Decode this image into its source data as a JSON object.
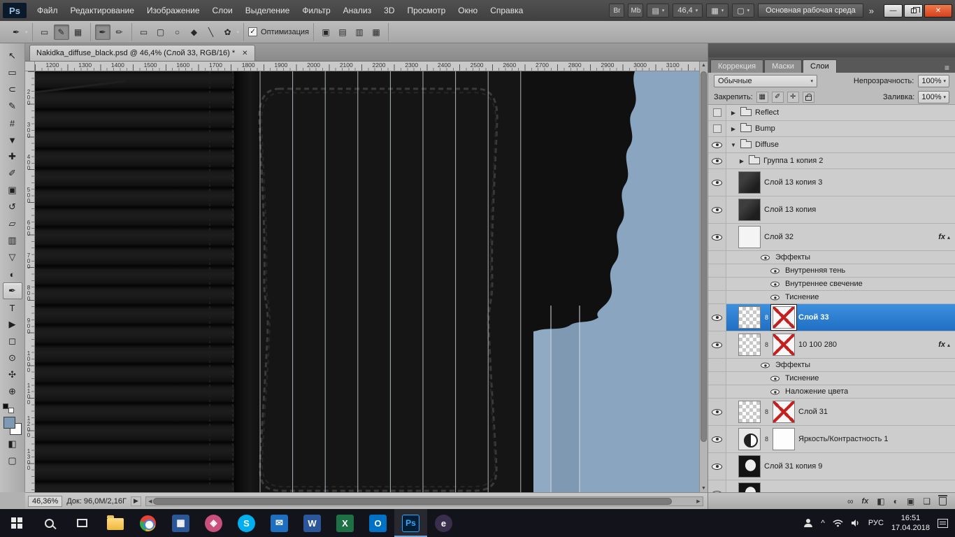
{
  "colors": {
    "selection_blue": "#2a7fd0",
    "canvas_blue": "#8aa5c0",
    "canvas_blue_dark": "#7f99b3",
    "canvas_blue_light": "#90aac3",
    "foreground_swatch": "#7d99b4",
    "background_swatch": "#ffffff"
  },
  "menubar": {
    "logo": "Ps",
    "items": [
      "Файл",
      "Редактирование",
      "Изображение",
      "Слои",
      "Выделение",
      "Фильтр",
      "Анализ",
      "3D",
      "Просмотр",
      "Окно",
      "Справка"
    ],
    "bridge_label": "Br",
    "minibridge_label": "Mb",
    "zoom_value": "46,4",
    "workspace_label": "Основная рабочая среда",
    "overflow_chevrons": "»"
  },
  "options_bar": {
    "tool_icon": "✒",
    "mode_icons": [
      "▭",
      "✎",
      "▦"
    ],
    "pen_icons": [
      "✒",
      "✏"
    ],
    "shape_icons": [
      "▭",
      "▢",
      "○",
      "◆",
      "╲",
      "✿"
    ],
    "optimization_label": "Оптимизация",
    "optimization_checked": true,
    "path_op_icons": [
      "▣",
      "▤",
      "▥",
      "▦"
    ]
  },
  "document_tab": {
    "title": "Nakidka_diffuse_black.psd @ 46,4% (Слой 33, RGB/16) *"
  },
  "toolbar": {
    "tools": [
      {
        "name": "move-tool",
        "glyph": "↖"
      },
      {
        "name": "marquee-tool",
        "glyph": "▭"
      },
      {
        "name": "lasso-tool",
        "glyph": "⊂"
      },
      {
        "name": "quick-selection-tool",
        "glyph": "✎"
      },
      {
        "name": "crop-tool",
        "glyph": "#"
      },
      {
        "name": "eyedropper-tool",
        "glyph": "▼"
      },
      {
        "name": "healing-brush-tool",
        "glyph": "✚"
      },
      {
        "name": "brush-tool",
        "glyph": "✐"
      },
      {
        "name": "clone-stamp-tool",
        "glyph": "▣"
      },
      {
        "name": "history-brush-tool",
        "glyph": "↺"
      },
      {
        "name": "eraser-tool",
        "glyph": "▱"
      },
      {
        "name": "gradient-tool",
        "glyph": "▥"
      },
      {
        "name": "blur-tool",
        "glyph": "▽"
      },
      {
        "name": "dodge-tool",
        "glyph": "◐"
      },
      {
        "name": "pen-tool",
        "glyph": "✒",
        "active": true
      },
      {
        "name": "type-tool",
        "glyph": "T"
      },
      {
        "name": "path-selection-tool",
        "glyph": "▶"
      },
      {
        "name": "rectangle-tool",
        "glyph": "◻"
      },
      {
        "name": "rotate-3d-tool",
        "glyph": "⊙"
      },
      {
        "name": "hand-tool",
        "glyph": "✣"
      },
      {
        "name": "zoom-tool",
        "glyph": "⊕"
      }
    ]
  },
  "rulers": {
    "horizontal": [
      1200,
      1300,
      1400,
      1500,
      1600,
      1700,
      1800,
      1900,
      2000,
      2100,
      2200,
      2300,
      2400,
      2500,
      2600,
      2700,
      2800,
      2900,
      3000,
      3100
    ],
    "vertical": [
      200,
      300,
      400,
      500,
      600,
      700,
      800,
      900,
      1000,
      1100,
      1200,
      1300
    ]
  },
  "layers_panel": {
    "dock_tabs": [
      "Коррекция",
      "Маски",
      "Слои"
    ],
    "active_tab": "Слои",
    "blend_mode": "Обычные",
    "opacity_label": "Непрозрачность:",
    "opacity_value": "100%",
    "lock_label": "Закрепить:",
    "fill_label": "Заливка:",
    "fill_value": "100%",
    "rows": [
      {
        "type": "group",
        "name": "Reflect",
        "eye": false,
        "expanded": false,
        "indent": 0
      },
      {
        "type": "group",
        "name": "Bump",
        "eye": false,
        "expanded": false,
        "indent": 0
      },
      {
        "type": "group",
        "name": "Diffuse",
        "eye": true,
        "expanded": true,
        "indent": 0
      },
      {
        "type": "group",
        "name": "Группа 1 копия 2",
        "eye": true,
        "expanded": false,
        "indent": 1
      },
      {
        "type": "layer",
        "name": "Слой 13 копия 3",
        "eye": true,
        "indent": 1,
        "thumb": "dark"
      },
      {
        "type": "layer",
        "name": "Слой 13 копия",
        "eye": true,
        "indent": 1,
        "thumb": "dark"
      },
      {
        "type": "layer",
        "name": "Слой 32",
        "eye": true,
        "indent": 1,
        "thumb": "white",
        "fx": true
      },
      {
        "type": "fx-header",
        "name": "Эффекты",
        "indent": 1
      },
      {
        "type": "fx-item",
        "name": "Внутренняя тень",
        "indent": 1
      },
      {
        "type": "fx-item",
        "name": "Внутреннее свечение",
        "indent": 1
      },
      {
        "type": "fx-item",
        "name": "Тиснение",
        "indent": 1
      },
      {
        "type": "layer",
        "name": "Слой 33",
        "eye": true,
        "indent": 1,
        "thumb": "checker",
        "mask": "redx",
        "link": true,
        "selected": true
      },
      {
        "type": "layer",
        "name": "10 100 280",
        "eye": true,
        "indent": 1,
        "thumb": "checker",
        "mask": "redx",
        "link": true,
        "fx": true
      },
      {
        "type": "fx-header",
        "name": "Эффекты",
        "indent": 1
      },
      {
        "type": "fx-item",
        "name": "Тиснение",
        "indent": 1
      },
      {
        "type": "fx-item",
        "name": "Наложение цвета",
        "indent": 1
      },
      {
        "type": "layer",
        "name": "Слой 31",
        "eye": true,
        "indent": 1,
        "thumb": "checker",
        "mask": "redx",
        "link": true
      },
      {
        "type": "layer",
        "name": "Яркость/Контрастность 1",
        "eye": true,
        "indent": 1,
        "thumb": "adjust",
        "mask": "white",
        "link": true
      },
      {
        "type": "layer",
        "name": "Слой 31 копия 9",
        "eye": true,
        "indent": 1,
        "thumb": "black"
      },
      {
        "type": "layer",
        "name": "",
        "eye": true,
        "indent": 1,
        "thumb": "black"
      }
    ],
    "bottom_icons": [
      {
        "name": "link-layers-icon",
        "glyph": "∞"
      },
      {
        "name": "layer-style-icon",
        "glyph": "fx"
      },
      {
        "name": "layer-mask-icon",
        "glyph": "◧"
      },
      {
        "name": "adjustment-layer-icon",
        "glyph": "◐"
      },
      {
        "name": "layer-group-icon",
        "glyph": "▣"
      },
      {
        "name": "new-layer-icon",
        "glyph": "❏"
      },
      {
        "name": "delete-layer-icon",
        "glyph": ""
      }
    ]
  },
  "status_bar": {
    "zoom": "46,36%",
    "doc_info": "Док: 96,0M/2,16Г"
  },
  "taskbar": {
    "apps": [
      {
        "name": "start-button"
      },
      {
        "name": "search-button"
      },
      {
        "name": "task-view-button"
      },
      {
        "name": "file-explorer"
      },
      {
        "name": "chrome"
      },
      {
        "name": "calculator",
        "style": "tile",
        "bg": "#2b5797",
        "label": "▦"
      },
      {
        "name": "graphics-app",
        "style": "round",
        "bg": "#c94f7c",
        "label": "◈"
      },
      {
        "name": "skype",
        "style": "round",
        "bg": "#00aff0",
        "label": "S"
      },
      {
        "name": "mail-app",
        "style": "tile",
        "bg": "#1e6fc0",
        "label": "✉"
      },
      {
        "name": "document-app",
        "style": "tile",
        "bg": "#2b579a",
        "label": "W"
      },
      {
        "name": "excel",
        "style": "tile",
        "bg": "#1e7145",
        "label": "X"
      },
      {
        "name": "outlook",
        "style": "tile",
        "bg": "#0072c6",
        "label": "O"
      },
      {
        "name": "photoshop",
        "style": "ps",
        "label": "Ps",
        "active": true
      },
      {
        "name": "dev-app",
        "style": "round",
        "bg": "#3a2e4d",
        "label": "e"
      }
    ],
    "tray": {
      "language": "РУС",
      "time": "16:51",
      "date": "17.04.2018"
    }
  }
}
